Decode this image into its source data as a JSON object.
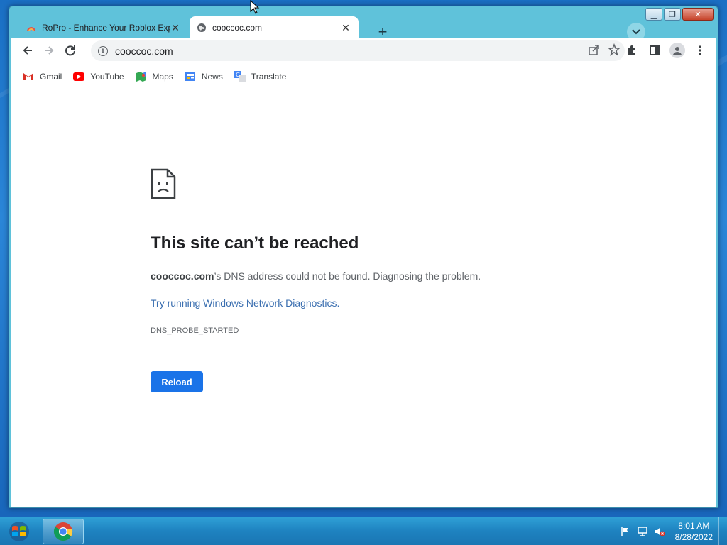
{
  "browser": {
    "tabs": [
      {
        "title": "RoPro - Enhance Your Roblox Experience",
        "active": false
      },
      {
        "title": "cooccoc.com",
        "active": true
      }
    ],
    "new_tab_symbol": "+",
    "tab_close_symbol": "✕",
    "address": "cooccoc.com",
    "bookmarks": [
      {
        "label": "Gmail",
        "icon": "gmail-icon"
      },
      {
        "label": "YouTube",
        "icon": "youtube-icon"
      },
      {
        "label": "Maps",
        "icon": "maps-icon"
      },
      {
        "label": "News",
        "icon": "news-icon"
      },
      {
        "label": "Translate",
        "icon": "translate-icon"
      }
    ]
  },
  "error_page": {
    "title": "This site can’t be reached",
    "domain": "cooccoc.com",
    "desc_rest": "’s DNS address could not be found. Diagnosing the problem.",
    "link": "Try running Windows Network Diagnostics.",
    "code": "DNS_PROBE_STARTED",
    "reload_label": "Reload"
  },
  "taskbar": {
    "time": "8:01 AM",
    "date": "8/28/2022"
  },
  "colors": {
    "accent": "#1a73e8",
    "link": "#3b6fb0",
    "frame": "#5fc2da"
  }
}
